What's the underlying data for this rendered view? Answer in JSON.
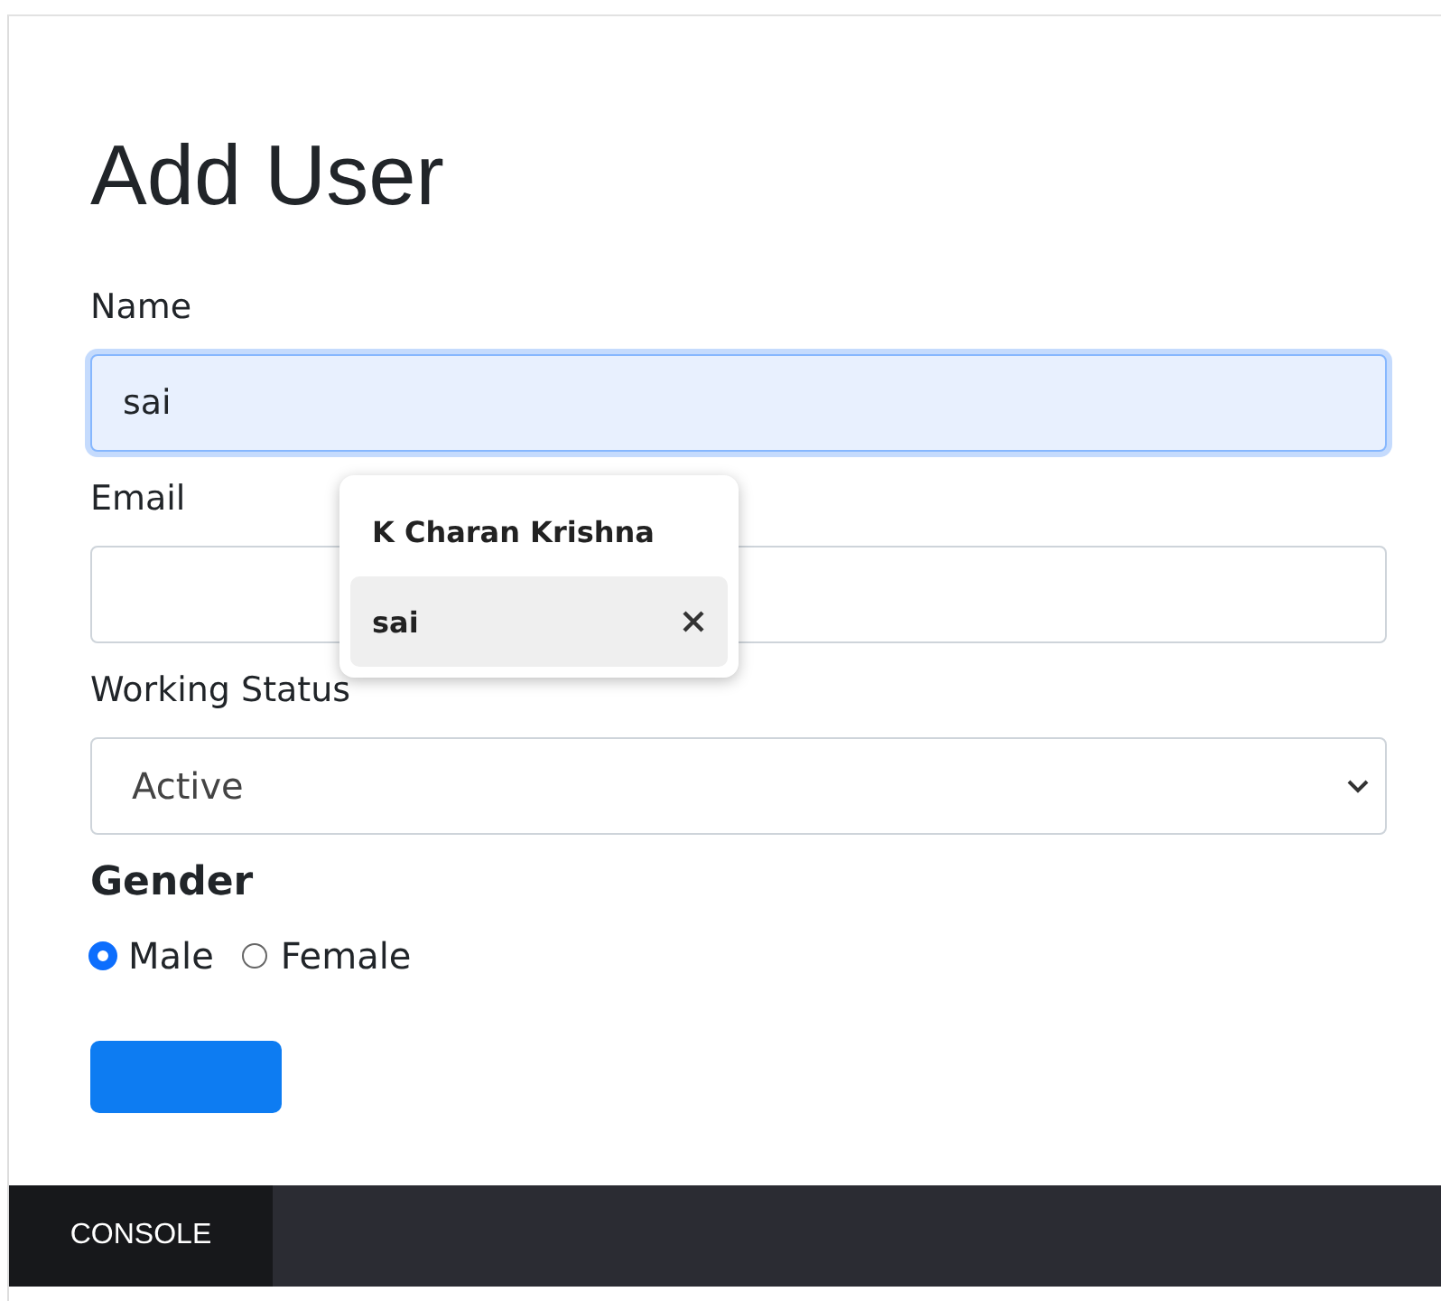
{
  "title": "Add User",
  "fields": [
    {
      "label": "Name",
      "kind": "text",
      "value": "sai",
      "focused": true
    },
    {
      "label": "Email",
      "kind": "text",
      "focused": false
    },
    {
      "label": "Working Status",
      "kind": "select",
      "value": "Active",
      "focused": false
    }
  ],
  "autocomplete": {
    "items": [
      {
        "label": "K Charan Krishna",
        "selected": false,
        "removable": false
      },
      {
        "label": "sai",
        "selected": true,
        "removable": true
      }
    ]
  },
  "gender": {
    "label": "Gender",
    "options": [
      {
        "label": "Male",
        "selected": true
      },
      {
        "label": "Female",
        "selected": false
      }
    ]
  },
  "console": {
    "tab": "CONSOLE"
  }
}
